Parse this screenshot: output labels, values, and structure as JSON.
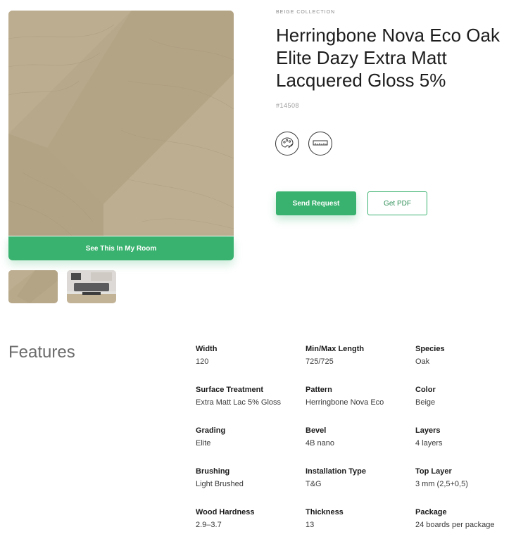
{
  "product": {
    "collection": "BEIGE COLLECTION",
    "title": "Herringbone Nova Eco Oak Elite Dazy Extra Matt Lacquered Gloss 5%",
    "sku": "#14508"
  },
  "icons": {
    "palette": "palette-icon",
    "ruler": "ruler-icon"
  },
  "actions": {
    "see_room": "See This In My Room",
    "send_request": "Send Request",
    "get_pdf": "Get PDF"
  },
  "colors": {
    "accent": "#3ab26f",
    "wood": "#b9a98c"
  },
  "features": {
    "title": "Features",
    "items": [
      {
        "name": "Width",
        "value": "120"
      },
      {
        "name": "Min/Max Length",
        "value": "725/725"
      },
      {
        "name": "Species",
        "value": "Oak"
      },
      {
        "name": "Surface Treatment",
        "value": "Extra Matt Lac 5% Gloss"
      },
      {
        "name": "Pattern",
        "value": "Herringbone Nova Eco"
      },
      {
        "name": "Color",
        "value": "Beige"
      },
      {
        "name": "Grading",
        "value": "Elite"
      },
      {
        "name": "Bevel",
        "value": "4B nano"
      },
      {
        "name": "Layers",
        "value": "4 layers"
      },
      {
        "name": "Brushing",
        "value": "Light Brushed"
      },
      {
        "name": "Installation Type",
        "value": "T&G"
      },
      {
        "name": "Top Layer",
        "value": "3 mm (2,5+0,5)"
      },
      {
        "name": "Wood Hardness",
        "value": "2.9–3.7"
      },
      {
        "name": "Thickness",
        "value": "13"
      },
      {
        "name": "Package",
        "value": "24 boards per package"
      }
    ]
  }
}
